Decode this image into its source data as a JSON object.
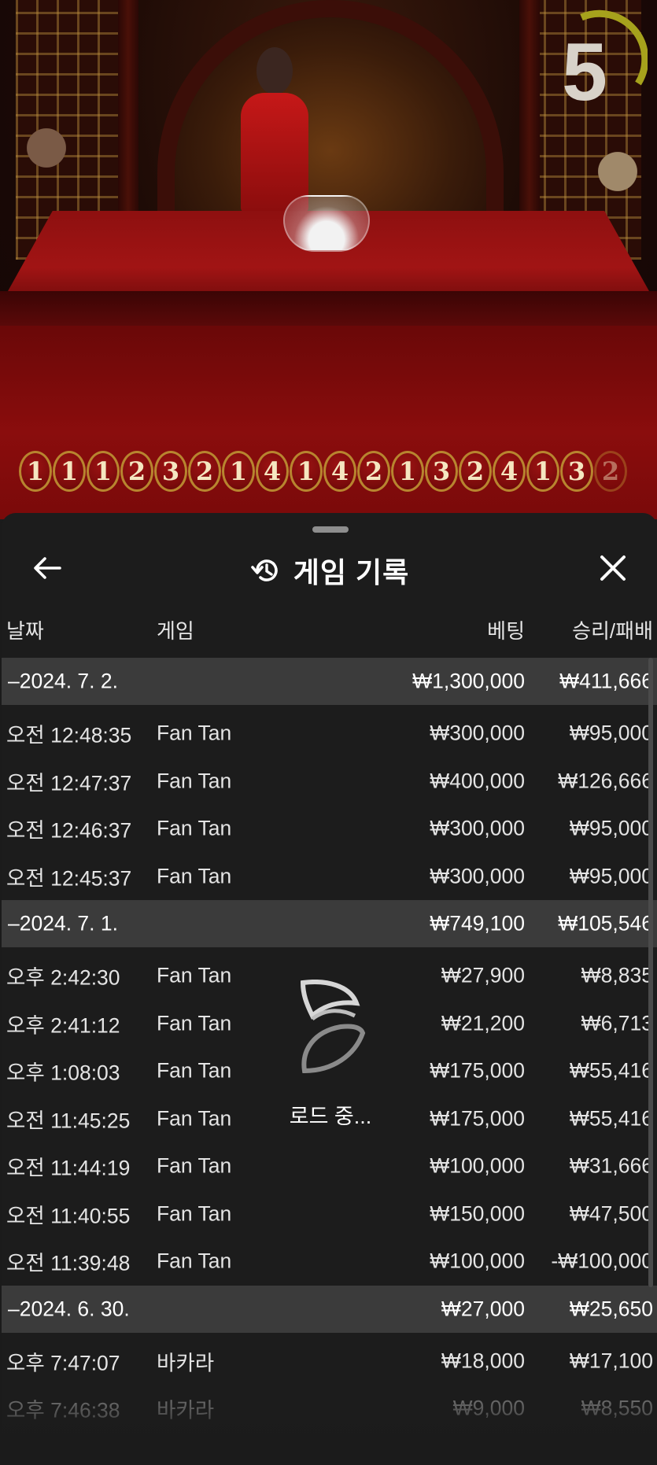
{
  "stage": {
    "timer": "5",
    "road": [
      "1",
      "1",
      "1",
      "2",
      "3",
      "2",
      "1",
      "4",
      "1",
      "4",
      "2",
      "1",
      "3",
      "2",
      "4",
      "1",
      "3",
      "2"
    ]
  },
  "sheet": {
    "title": "게임 기록",
    "icons": {
      "back": "arrow-left-icon",
      "history": "history-icon",
      "close": "close-icon"
    },
    "columns": {
      "date": "날짜",
      "game": "게임",
      "bet": "베팅",
      "winloss": "승리/패배"
    },
    "groups": [
      {
        "date": "–2024. 7. 2.",
        "bet": "₩1,300,000",
        "winloss": "₩411,666",
        "rows": [
          {
            "time": "오전 12:48:35",
            "game": "Fan Tan",
            "bet": "₩300,000",
            "winloss": "₩95,000"
          },
          {
            "time": "오전 12:47:37",
            "game": "Fan Tan",
            "bet": "₩400,000",
            "winloss": "₩126,666"
          },
          {
            "time": "오전 12:46:37",
            "game": "Fan Tan",
            "bet": "₩300,000",
            "winloss": "₩95,000"
          },
          {
            "time": "오전 12:45:37",
            "game": "Fan Tan",
            "bet": "₩300,000",
            "winloss": "₩95,000"
          }
        ]
      },
      {
        "date": "–2024. 7. 1.",
        "bet": "₩749,100",
        "winloss": "₩105,546",
        "rows": [
          {
            "time": "오후 2:42:30",
            "game": "Fan Tan",
            "bet": "₩27,900",
            "winloss": "₩8,835"
          },
          {
            "time": "오후 2:41:12",
            "game": "Fan Tan",
            "bet": "₩21,200",
            "winloss": "₩6,713"
          },
          {
            "time": "오후 1:08:03",
            "game": "Fan Tan",
            "bet": "₩175,000",
            "winloss": "₩55,416"
          },
          {
            "time": "오전 11:45:25",
            "game": "Fan Tan",
            "bet": "₩175,000",
            "winloss": "₩55,416"
          },
          {
            "time": "오전 11:44:19",
            "game": "Fan Tan",
            "bet": "₩100,000",
            "winloss": "₩31,666"
          },
          {
            "time": "오전 11:40:55",
            "game": "Fan Tan",
            "bet": "₩150,000",
            "winloss": "₩47,500"
          },
          {
            "time": "오전 11:39:48",
            "game": "Fan Tan",
            "bet": "₩100,000",
            "winloss": "-₩100,000"
          }
        ]
      },
      {
        "date": "–2024. 6. 30.",
        "bet": "₩27,000",
        "winloss": "₩25,650",
        "rows": [
          {
            "time": "오후 7:47:07",
            "game": "바카라",
            "bet": "₩18,000",
            "winloss": "₩17,100"
          },
          {
            "time": "오후 7:46:38",
            "game": "바카라",
            "bet": "₩9,000",
            "winloss": "₩8,550"
          }
        ]
      }
    ],
    "loading_text": "로드 중..."
  }
}
